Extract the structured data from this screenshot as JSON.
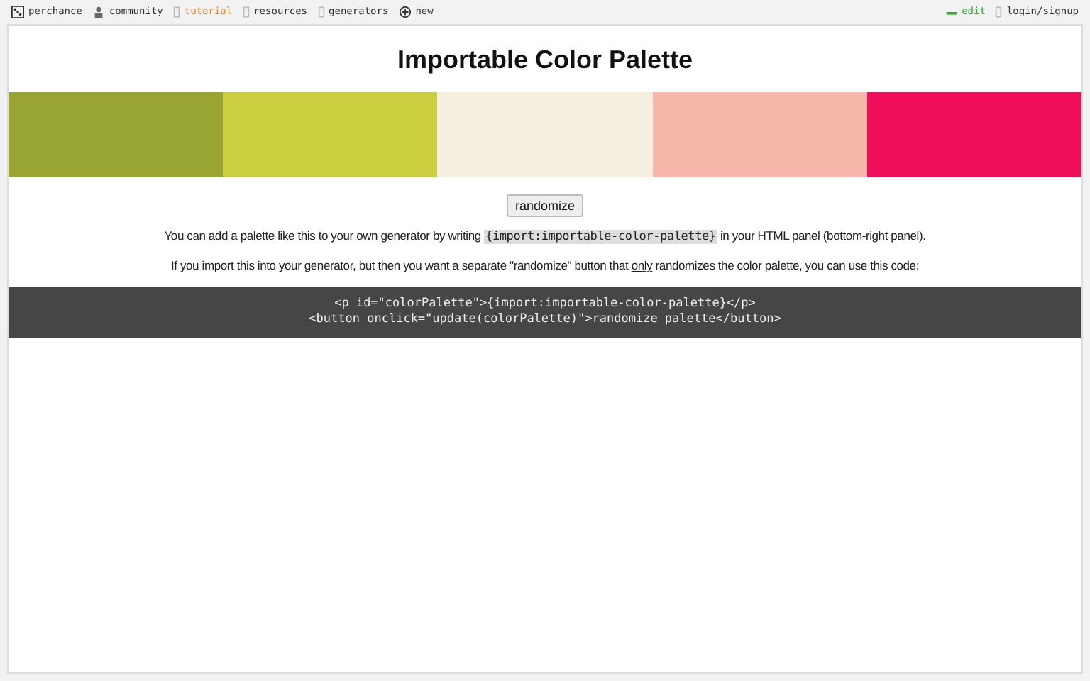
{
  "nav": {
    "brand": "perchance",
    "items": [
      {
        "label": "community",
        "kind": "people",
        "selected": false
      },
      {
        "label": "tutorial",
        "kind": "page",
        "selected": true
      },
      {
        "label": "resources",
        "kind": "page",
        "selected": false
      },
      {
        "label": "generators",
        "kind": "page",
        "selected": false
      },
      {
        "label": "new",
        "kind": "create",
        "selected": false
      }
    ],
    "right": [
      {
        "label": "edit",
        "kind": "edit"
      },
      {
        "label": "login/signup",
        "kind": "login"
      }
    ]
  },
  "title": "Importable Color Palette",
  "palette": [
    {
      "color": "#9aa634"
    },
    {
      "color": "#cbcf3f"
    },
    {
      "color": "#f5efdf"
    },
    {
      "color": "#f6b8ab"
    },
    {
      "color": "#ef0e5a"
    }
  ],
  "randomize_button": "randomize",
  "paragraph_1": {
    "before": "You can add a palette like this to your own generator by writing ",
    "code": "{import:importable-color-palette}",
    "after": " in your HTML panel (bottom-right panel)."
  },
  "paragraph_2": {
    "before": "If you import this into your generator, but then you want a separate \"randomize\" button that ",
    "underlined": "only",
    "after": " randomizes the color palette, you can use this code:"
  },
  "code_block": [
    "<p id=\"colorPalette\">{import:importable-color-palette}</p>",
    "<button onclick=\"update(colorPalette)\">randomize palette</button>"
  ]
}
